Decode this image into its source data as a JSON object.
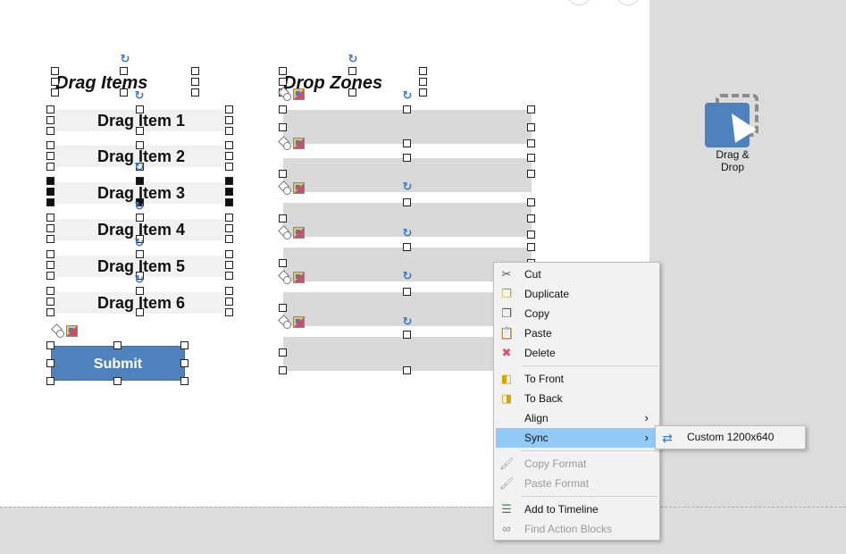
{
  "left_column": {
    "heading": "Drag Items",
    "items": [
      "Drag Item 1",
      "Drag Item 2",
      "Drag Item 3",
      "Drag Item 4",
      "Drag Item 5",
      "Drag Item 6"
    ],
    "submit_label": "Submit"
  },
  "right_column": {
    "heading": "Drop Zones",
    "zone_count": 6
  },
  "widget": {
    "label": "Drag & Drop"
  },
  "context_menu": {
    "items": [
      {
        "label": "Cut",
        "icon": "scissors-icon"
      },
      {
        "label": "Duplicate",
        "icon": "duplicate-icon"
      },
      {
        "label": "Copy",
        "icon": "copy-icon"
      },
      {
        "label": "Paste",
        "icon": "paste-icon"
      },
      {
        "label": "Delete",
        "icon": "delete-icon"
      },
      {
        "label": "To Front",
        "icon": "to-front-icon"
      },
      {
        "label": "To Back",
        "icon": "to-back-icon"
      },
      {
        "label": "Align",
        "icon": ""
      },
      {
        "label": "Sync",
        "icon": ""
      },
      {
        "label": "Copy Format",
        "icon": "copy-format-icon"
      },
      {
        "label": "Paste Format",
        "icon": "paste-format-icon"
      },
      {
        "label": "Add to Timeline",
        "icon": "add-timeline-icon"
      },
      {
        "label": "Find Action Blocks",
        "icon": "binoculars-icon"
      }
    ],
    "sync_submenu": {
      "label": "Custom 1200x640",
      "icon": "sync-icon"
    }
  },
  "colors": {
    "accent": "#4f82bd",
    "menu_highlight": "#91c9f7",
    "drop_zone": "#d9d9d9"
  }
}
